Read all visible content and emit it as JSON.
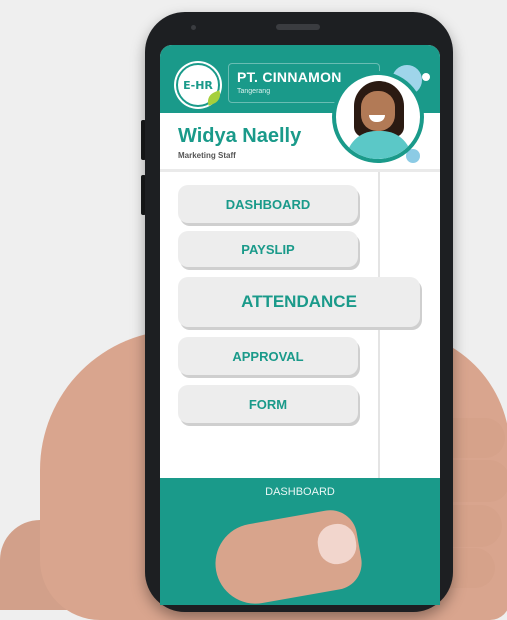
{
  "header": {
    "logo_text": "E-HR",
    "company_name": "PT. CINNAMON",
    "company_city": "Tangerang"
  },
  "user": {
    "name": "Widya Naelly",
    "role": "Marketing Staff"
  },
  "menu": {
    "dashboard": "DASHBOARD",
    "payslip": "PAYSLIP",
    "attendance": "ATTENDANCE",
    "approval": "APPROVAL",
    "form": "FORM"
  },
  "bottom_bar": {
    "label": "DASHBOARD"
  },
  "colors": {
    "brand": "#1a9a8a",
    "button_bg": "#ededed",
    "accent_leaf": "#a5cf3c"
  },
  "icons": {
    "logo": "ehr-logo-icon",
    "avatar": "user-avatar-icon"
  }
}
